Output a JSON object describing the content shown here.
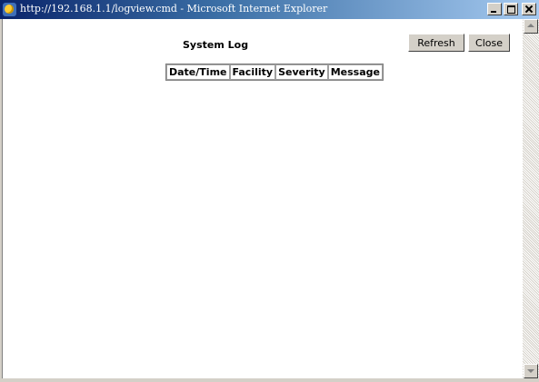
{
  "window": {
    "title": "http://192.168.1.1/logview.cmd - Microsoft Internet Explorer",
    "icon": "ie-icon"
  },
  "page": {
    "title": "System Log",
    "buttons": {
      "refresh_label": "Refresh",
      "close_label": "Close"
    },
    "table": {
      "headers": [
        "Date/Time",
        "Facility",
        "Severity",
        "Message"
      ],
      "rows": []
    }
  }
}
